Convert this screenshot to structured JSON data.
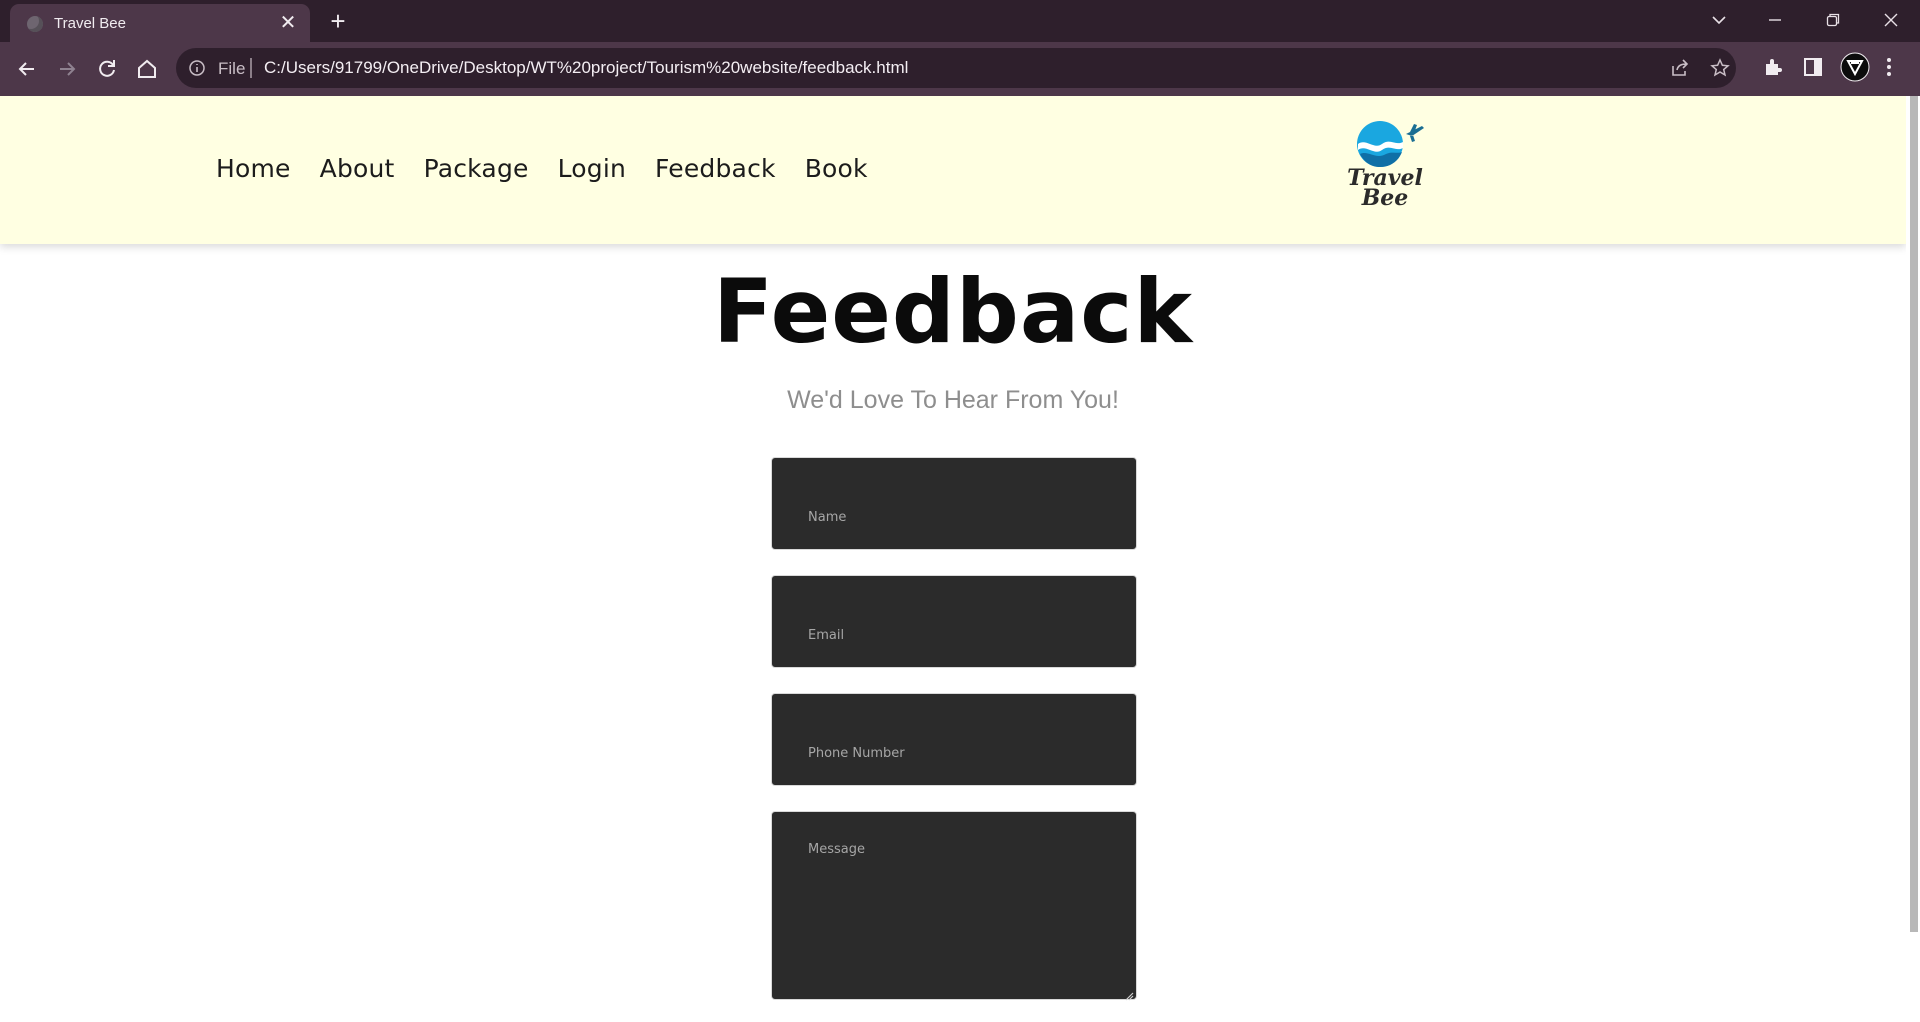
{
  "browser": {
    "tab_title": "Travel Bee",
    "tab_close": "✕",
    "new_tab": "+",
    "scheme_label": "File",
    "url": "C:/Users/91799/OneDrive/Desktop/WT%20project/Tourism%20website/feedback.html"
  },
  "site": {
    "nav": [
      "Home",
      "About",
      "Package",
      "Login",
      "Feedback",
      "Book"
    ],
    "logo_line1": "Travel",
    "logo_line2": "Bee",
    "colors": {
      "header_bg": "#ffffe2",
      "field_bg": "#2b2b2b",
      "logo_blue": "#1aa7e0"
    }
  },
  "feedback": {
    "title": "Feedback",
    "subtitle": "We'd Love To Hear From You!",
    "fields": {
      "name_placeholder": "Name",
      "email_placeholder": "Email",
      "phone_placeholder": "Phone Number",
      "message_placeholder": "Message"
    }
  }
}
